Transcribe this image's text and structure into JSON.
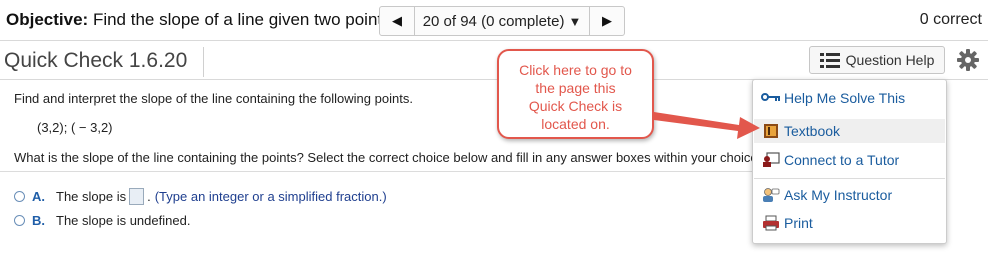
{
  "header": {
    "objective_label": "Objective:",
    "objective_text": "Find the slope of a line given two points.",
    "pager_text": "20 of 94 (0 complete)",
    "score": "0 correct"
  },
  "title": {
    "text": "Quick Check 1.6.20",
    "question_help_label": "Question Help"
  },
  "problem": {
    "prompt": "Find and interpret the slope of the line containing the following points.",
    "points": "(3,2); ( − 3,2)",
    "question": "What is the slope of the line containing the points? Select the correct choice below and fill in any answer boxes within your choice."
  },
  "choices": [
    {
      "letter": "A.",
      "pre": "The slope is",
      "post": ".",
      "hint": "(Type an integer or a simplified fraction.)"
    },
    {
      "letter": "B.",
      "text": "The slope is undefined."
    }
  ],
  "help_menu": {
    "items": [
      {
        "label": "Help Me Solve This",
        "icon": "key-icon"
      },
      {
        "label": "Textbook",
        "icon": "book-icon"
      },
      {
        "label": "Connect to a Tutor",
        "icon": "tutor-icon"
      },
      {
        "label": "Ask My Instructor",
        "icon": "instructor-icon"
      },
      {
        "label": "Print",
        "icon": "printer-icon"
      }
    ]
  },
  "callout": {
    "text": "Click here to go to\nthe page this\nQuick Check is\nlocated on."
  },
  "colors": {
    "link": "#1a5c9e",
    "choice_letter": "#1f5ea8",
    "callout": "#e2574c"
  }
}
